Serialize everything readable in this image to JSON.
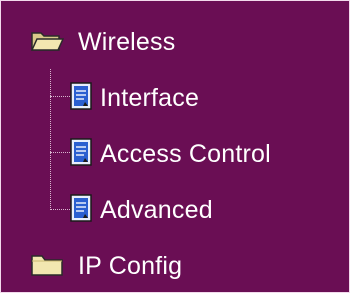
{
  "tree": {
    "wireless": {
      "label": "Wireless",
      "icon": "folder-open-icon",
      "expanded": true,
      "children": [
        {
          "label": "Interface",
          "icon": "document-icon"
        },
        {
          "label": "Access Control",
          "icon": "document-icon"
        },
        {
          "label": "Advanced",
          "icon": "document-icon"
        }
      ]
    },
    "ip_config": {
      "label": "IP Config",
      "icon": "folder-closed-icon",
      "expanded": false
    }
  },
  "colors": {
    "background": "#6a0e54",
    "text": "#ffffff",
    "border": "#f2d9ec",
    "folder": "#f2e7b0",
    "document": "#2b5fd0"
  }
}
